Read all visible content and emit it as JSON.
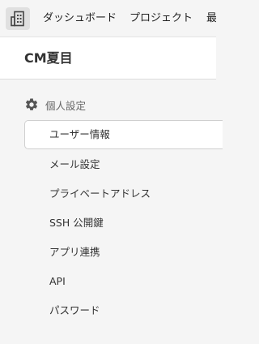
{
  "header": {
    "nav": [
      "ダッシュボード",
      "プロジェクト",
      "最"
    ]
  },
  "page": {
    "title": "CM夏目"
  },
  "settings": {
    "section_label": "個人設定",
    "items": [
      {
        "label": "ユーザー情報",
        "active": true
      },
      {
        "label": "メール設定",
        "active": false
      },
      {
        "label": "プライベートアドレス",
        "active": false
      },
      {
        "label": "SSH 公開鍵",
        "active": false
      },
      {
        "label": "アプリ連携",
        "active": false
      },
      {
        "label": "API",
        "active": false
      },
      {
        "label": "パスワード",
        "active": false
      }
    ]
  },
  "colors": {
    "background": "#f5f5f5",
    "panel": "#ffffff",
    "icon": "#555555"
  },
  "icons": [
    "building-icon",
    "gear-icon"
  ]
}
